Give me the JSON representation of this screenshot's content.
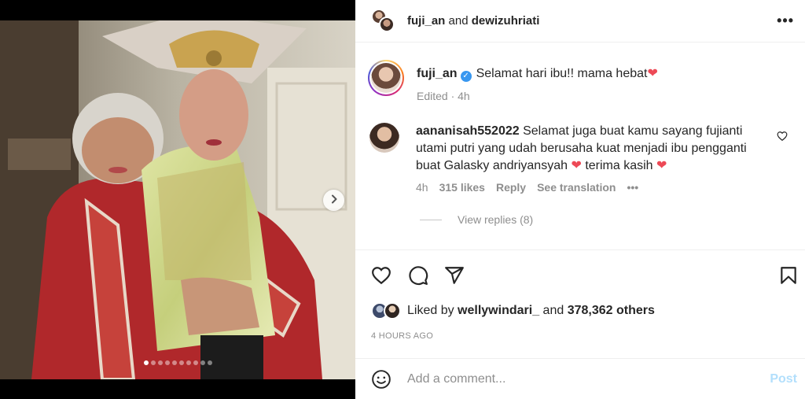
{
  "post": {
    "header": {
      "user1": "fuji_an",
      "joiner": " and ",
      "user2": "dewizuhriati",
      "more_icon": "more-horizontal-icon"
    },
    "caption": {
      "username": "fuji_an",
      "verified_icon": "verified-badge-icon",
      "text": "Selamat hari ibu!! mama hebat",
      "emoji": "❤",
      "meta": "Edited · 4h"
    },
    "comment": {
      "username": "aananisah552022",
      "text_part1": "Selamat juga buat kamu sayang fujianti utami putri yang udah berusaha kuat menjadi ibu pengganti buat Galasky andriyansyah",
      "emoji1": "❤",
      "text_part2": "terima kasih",
      "emoji2": "❤",
      "time": "4h",
      "likes": "315 likes",
      "reply": "Reply",
      "translate": "See translation",
      "more": "•••",
      "view_replies": "View replies (8)"
    },
    "likes": {
      "prefix": "Liked by ",
      "user": "wellywindari_",
      "middle": " and ",
      "count": "378,362 others"
    },
    "time_ago": "4 HOURS AGO",
    "add_comment": {
      "placeholder": "Add a comment...",
      "post_label": "Post"
    },
    "carousel": {
      "total": 10,
      "active_index": 1
    }
  },
  "colors": {
    "verified": "#3897f0",
    "heart": "#ed4956",
    "post_disabled": "#b2dffc",
    "meta": "#8e8e8e"
  }
}
